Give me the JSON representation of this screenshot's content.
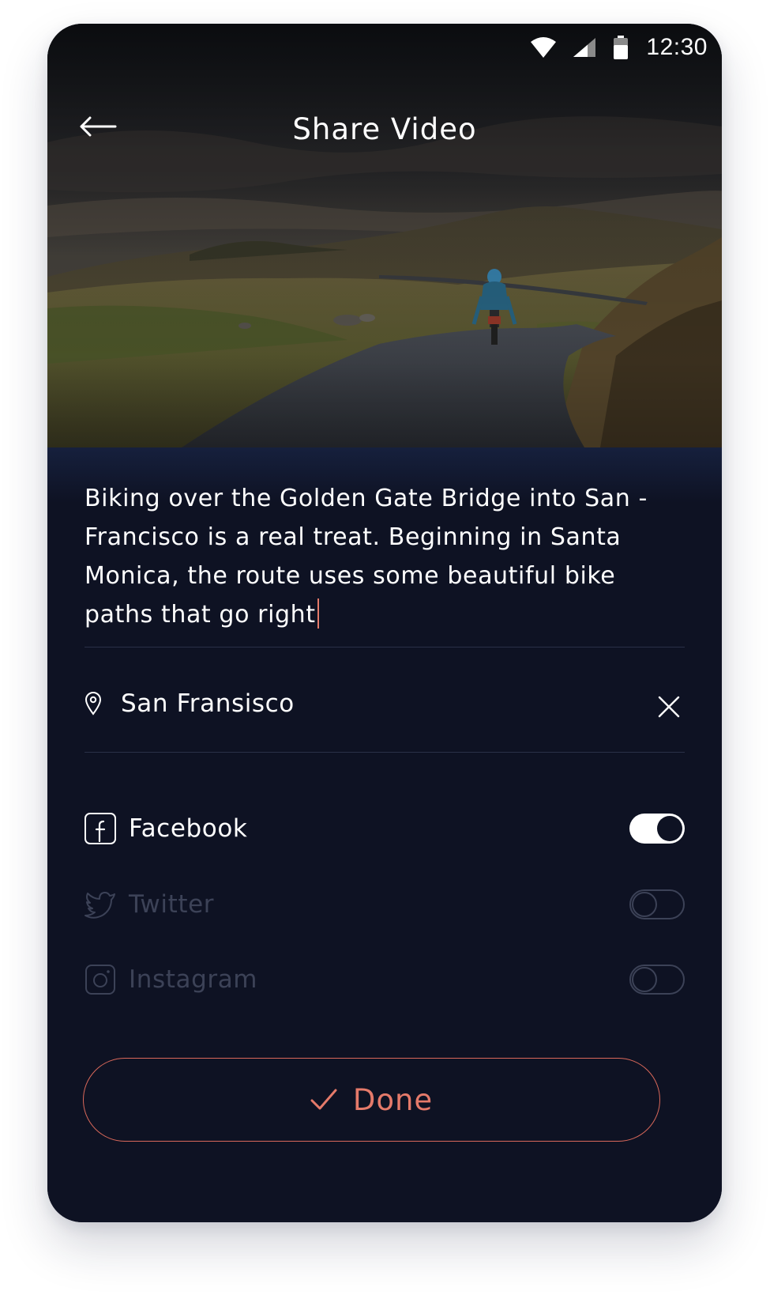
{
  "status_bar": {
    "time": "12:30",
    "icons": [
      "wifi-icon",
      "cellular-signal-icon",
      "battery-icon"
    ]
  },
  "header": {
    "title": "Share Video",
    "back_icon": "arrow-left-icon"
  },
  "hero": {
    "subject": "cyclist on mountain road at dusk"
  },
  "description": {
    "text": "Biking over the Golden Gate Bridge into San -\nFrancisco is a real treat. Beginning in Santa\nMonica, the route uses some beautiful bike\npaths that go right"
  },
  "location": {
    "icon": "map-pin-icon",
    "value": "San Fransisco",
    "clear_icon": "close-icon"
  },
  "social": [
    {
      "label": "Facebook",
      "icon": "facebook-icon",
      "enabled": true
    },
    {
      "label": "Twitter",
      "icon": "twitter-icon",
      "enabled": false
    },
    {
      "label": "Instagram",
      "icon": "instagram-icon",
      "enabled": false
    }
  ],
  "done": {
    "label": "Done",
    "icon": "check-icon"
  },
  "colors": {
    "background": "#0e1223",
    "accent": "#e57a6a",
    "muted": "#3c4257",
    "text": "#ffffff"
  }
}
